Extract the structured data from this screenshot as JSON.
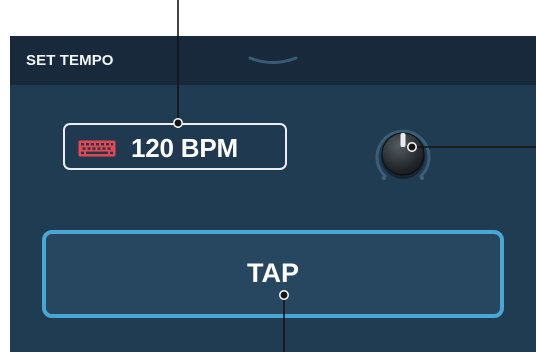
{
  "panel": {
    "title": "SET TEMPO"
  },
  "tempo_display": {
    "input_icon": "keyboard-icon",
    "value": "120 BPM"
  },
  "knob": {
    "icon": "rotary-knob-icon"
  },
  "tap_button": {
    "label": "TAP"
  },
  "colors": {
    "panel_background": "#203c53",
    "header_background": "#17293a",
    "keyboard_icon": "#e8474e",
    "tap_border": "#4aa6d4",
    "tap_background": "#26475f"
  }
}
